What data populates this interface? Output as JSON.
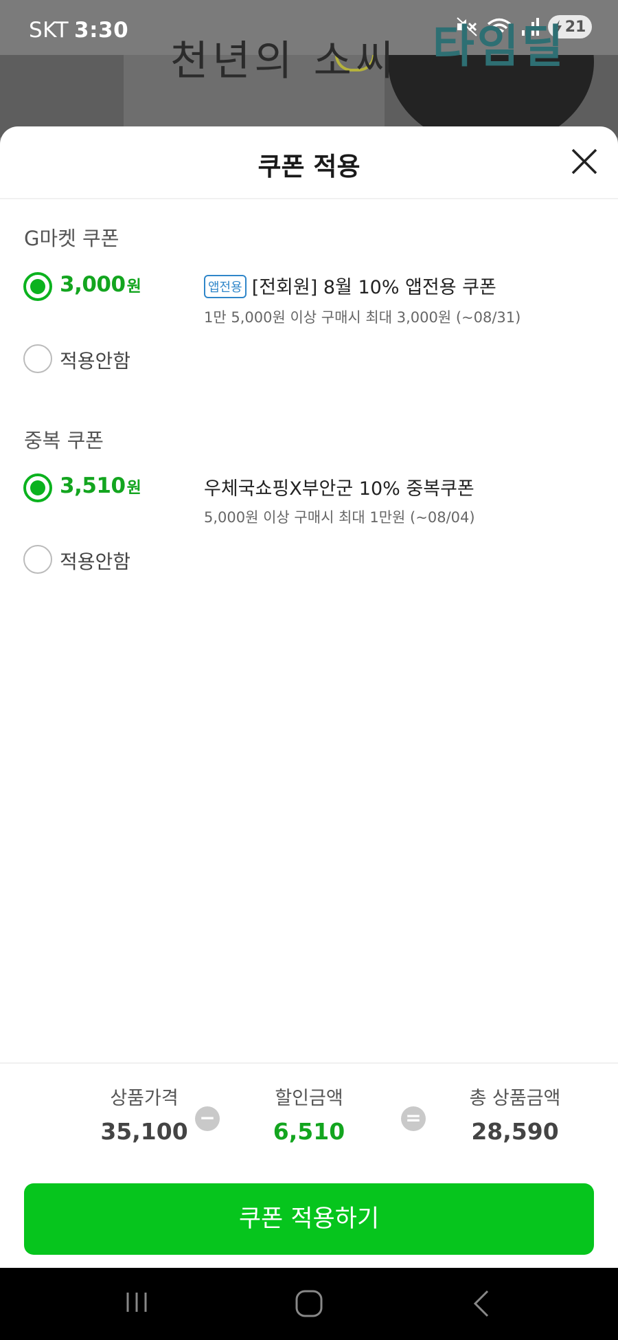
{
  "status_bar": {
    "carrier": "SKT",
    "time": "3:30",
    "battery": "21"
  },
  "background": {
    "book_text": "천년의 소씨",
    "circle_text": "타임딜"
  },
  "sheet": {
    "title": "쿠폰 적용",
    "gmarket_section": {
      "title": "G마켓 쿠폰",
      "selected_amount": "3,000",
      "unit": "원",
      "coupon_badge": "앱전용",
      "coupon_title": "[전회원] 8월 10% 앱전용 쿠폰",
      "coupon_desc": "1만 5,000원 이상 구매시 최대 3,000원 (~08/31)",
      "none_label": "적용안함"
    },
    "duplicate_section": {
      "title": "중복 쿠폰",
      "selected_amount": "3,510",
      "unit": "원",
      "coupon_title": "우체국쇼핑X부안군 10% 중복쿠폰",
      "coupon_desc": "5,000원 이상 구매시 최대 1만원 (~08/04)",
      "none_label": "적용안함"
    }
  },
  "summary": {
    "product_price_label": "상품가격",
    "product_price": "35,100",
    "minus": "−",
    "discount_label": "할인금액",
    "discount": "6,510",
    "equals": "=",
    "total_label": "총 상품금액",
    "total": "28,590"
  },
  "apply_button": "쿠폰 적용하기",
  "colors": {
    "accent_green": "#06c51d",
    "amount_green": "#13a51f",
    "badge_blue": "#2f86c9"
  }
}
